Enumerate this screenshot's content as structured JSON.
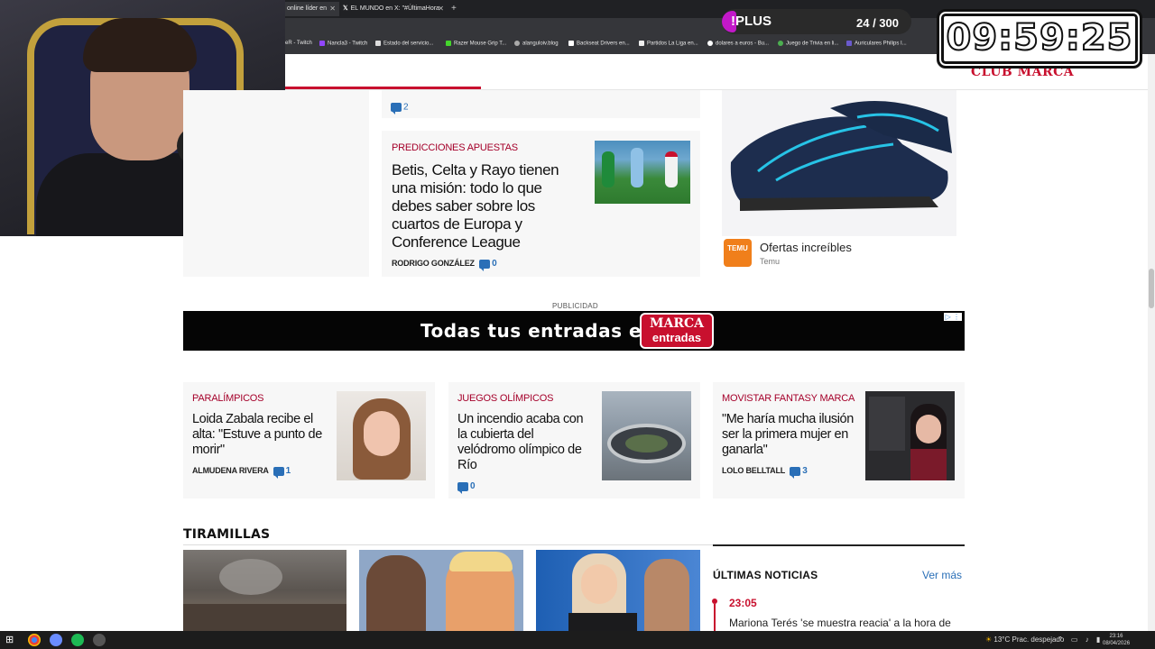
{
  "browser": {
    "tabs": [
      {
        "title": "online líder en"
      },
      {
        "title": "EL MUNDO en X: \"#ÚltimaHora"
      }
    ],
    "new_tab": "+",
    "bookmarks": [
      "eR - Twitch",
      "Nancla3 - Twitch",
      "Estado del servicio...",
      "Razer Mouse Grip T...",
      "alanguloiv.blog",
      "Backseat Drivers en...",
      "Partidos La Liga en...",
      "dolares a euros - Bu...",
      "Juego de Trivia en li...",
      "Auriculares Philips I..."
    ]
  },
  "overlay": {
    "plus_label": "!PLUS",
    "plus_count": "24 / 300",
    "timer": "09:59:25"
  },
  "header": {
    "brand": "CLUB MARCA"
  },
  "articles": {
    "top_comment_count": "2",
    "betis": {
      "kicker": "PREDICCIONES APUESTAS",
      "title": "Betis, Celta y Rayo tienen una misión: todo lo que debes saber sobre los cuartos de Europa y Conference League",
      "author": "RODRIGO GONZÁLEZ",
      "comments": "0"
    },
    "row": [
      {
        "kicker": "PARALÍMPICOS",
        "title": "Loida Zabala recibe el alta: \"Estuve a punto de morir\"",
        "author": "ALMUDENA RIVERA",
        "comments": "1"
      },
      {
        "kicker": "JUEGOS OLÍMPICOS",
        "title": "Un incendio acaba con la cubierta del velódromo olímpico de Río",
        "author": "",
        "comments": "0"
      },
      {
        "kicker": "MOVISTAR FANTASY MARCA",
        "title": "\"Me haría mucha ilusión ser la primera mujer en ganarla\"",
        "author": "LOLO BELLTALL",
        "comments": "3"
      }
    ]
  },
  "sponsored": {
    "title": "Ofertas increíbles",
    "source": "Temu",
    "logo_text": "TEMU"
  },
  "ad": {
    "label": "PUBLICIDAD",
    "text": "Todas tus entradas en",
    "logo_top": "MARCA",
    "logo_bottom": "entradas"
  },
  "tiramillas": {
    "title": "TIRAMILLAS"
  },
  "latest_news": {
    "title": "ÚLTIMAS NOTICIAS",
    "more": "Ver más",
    "items": [
      {
        "time": "23:05",
        "text": "Mariona Terés 'se muestra reacia' a la hora de"
      }
    ]
  },
  "taskbar": {
    "weather": "13°C  Prac. despejado",
    "time": "23:16",
    "date": "08/04/2026"
  },
  "colors": {
    "accent": "#c8102e",
    "link": "#2a6fb7",
    "plus": "#c218c9"
  }
}
